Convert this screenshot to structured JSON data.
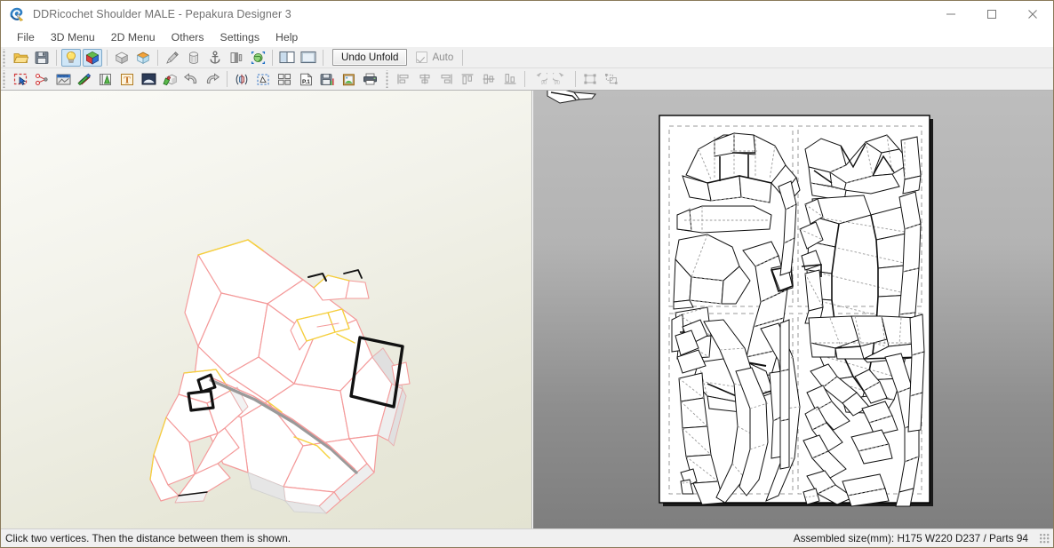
{
  "window": {
    "title": "DDRicochet Shoulder MALE - Pepakura Designer 3",
    "app_icon": "pepakura-app-icon",
    "minimize_label": "Minimize",
    "maximize_label": "Maximize",
    "close_label": "Close",
    "accent_border": "#8a7a5a"
  },
  "menubar": {
    "items": [
      {
        "label": "File"
      },
      {
        "label": "3D Menu"
      },
      {
        "label": "2D Menu"
      },
      {
        "label": "Others"
      },
      {
        "label": "Settings"
      },
      {
        "label": "Help"
      }
    ]
  },
  "toolbar1": {
    "buttons": [
      {
        "icon": "open-folder-icon",
        "name": "open-file-button",
        "state": "normal"
      },
      {
        "icon": "save-floppy-icon",
        "name": "save-file-button",
        "state": "normal"
      },
      {
        "icon": "lightbulb-icon",
        "name": "toggle-lighting-button",
        "state": "active"
      },
      {
        "icon": "color-cube-icon",
        "name": "toggle-texture-button",
        "state": "active"
      },
      {
        "icon": "gray-cube-icon",
        "name": "flat-shading-button",
        "state": "normal"
      },
      {
        "icon": "blue-cube-icon",
        "name": "smooth-shading-button",
        "state": "normal"
      },
      {
        "icon": "pencil-icon",
        "name": "edit-tool-button",
        "state": "normal"
      },
      {
        "icon": "cylinder-icon",
        "name": "cylinder-tool-button",
        "state": "normal"
      },
      {
        "icon": "anchor-icon",
        "name": "anchor-tool-button",
        "state": "normal"
      },
      {
        "icon": "shade-panel-icon",
        "name": "shading-panel-button",
        "state": "normal"
      },
      {
        "icon": "globe-select-icon",
        "name": "select-all-faces-button",
        "state": "normal"
      },
      {
        "icon": "split-horizontal-icon",
        "name": "layout-side-by-side-button",
        "state": "normal"
      },
      {
        "icon": "single-pane-icon",
        "name": "layout-single-button",
        "state": "normal"
      }
    ],
    "undo_unfold_label": "Undo Unfold",
    "auto_label": "Auto",
    "auto_checked": true
  },
  "toolbar2": {
    "buttons": [
      {
        "icon": "rectangle-select-icon",
        "name": "select-parts-button"
      },
      {
        "icon": "join-divide-icon",
        "name": "join-divide-face-button"
      },
      {
        "icon": "scale-ruler-icon",
        "name": "scale-measure-button"
      },
      {
        "icon": "flaps-icon",
        "name": "edit-flaps-button"
      },
      {
        "icon": "edge-id-icon",
        "name": "edge-numbering-button"
      },
      {
        "icon": "text-tool-icon",
        "name": "add-text-button"
      },
      {
        "icon": "image-tool-icon",
        "name": "add-image-button"
      },
      {
        "icon": "paint-3d-icon",
        "name": "paint-texture-button"
      },
      {
        "icon": "undo-arrow-icon",
        "name": "undo-button"
      },
      {
        "icon": "redo-arrow-icon",
        "name": "redo-button"
      },
      {
        "icon": "flip-part-icon",
        "name": "flip-part-button"
      },
      {
        "icon": "bounding-box-icon",
        "name": "fit-part-button"
      },
      {
        "icon": "arrange-parts-icon",
        "name": "arrange-parts-button"
      },
      {
        "icon": "page-p1-icon",
        "name": "page-setup-button"
      },
      {
        "icon": "save-export-icon",
        "name": "export-button"
      },
      {
        "icon": "clipboard-image-icon",
        "name": "copy-image-button"
      },
      {
        "icon": "printer-icon",
        "name": "print-button"
      },
      {
        "icon": "align-left-icon",
        "name": "align-left-button",
        "state": "disabled"
      },
      {
        "icon": "align-center-icon",
        "name": "align-center-button",
        "state": "disabled"
      },
      {
        "icon": "align-right-icon",
        "name": "align-right-button",
        "state": "disabled"
      },
      {
        "icon": "align-top-icon",
        "name": "align-top-button",
        "state": "disabled"
      },
      {
        "icon": "align-middle-icon",
        "name": "align-middle-button",
        "state": "disabled"
      },
      {
        "icon": "align-bottom-icon",
        "name": "align-bottom-button",
        "state": "disabled"
      },
      {
        "icon": "rotate-ccw-90-icon",
        "name": "rotate-ccw-90-button",
        "state": "disabled"
      },
      {
        "icon": "rotate-cw-90-icon",
        "name": "rotate-cw-90-button",
        "state": "disabled"
      },
      {
        "icon": "group-parts-icon",
        "name": "group-parts-button",
        "state": "disabled"
      },
      {
        "icon": "ungroup-parts-icon",
        "name": "ungroup-parts-button",
        "state": "disabled"
      }
    ]
  },
  "panel3d": {
    "name": "3d-model-viewport",
    "model_label": "DDRicochet Shoulder MALE 3D model",
    "edge_color": "#f2a0a0",
    "highlight_color": "#f7d33a",
    "selection_color": "#000000",
    "face_color": "#ffffff",
    "background_top": "#fbfbf7",
    "background_bottom": "#e3e3d2"
  },
  "panel2d": {
    "name": "2d-unfold-viewport",
    "page_label": "Unfolded pattern page",
    "background_top": "#bdbdbd",
    "background_bottom": "#7e7e7e",
    "page_color": "#ffffff",
    "cut_line_color": "#000000",
    "fold_line_color": "#9a9a9a",
    "margin_guide_color": "#9a9a9a"
  },
  "statusbar": {
    "hint": "Click two vertices. Then the distance between them is shown.",
    "assembled_info": "Assembled size(mm): H175 W220 D237 / Parts 94"
  }
}
